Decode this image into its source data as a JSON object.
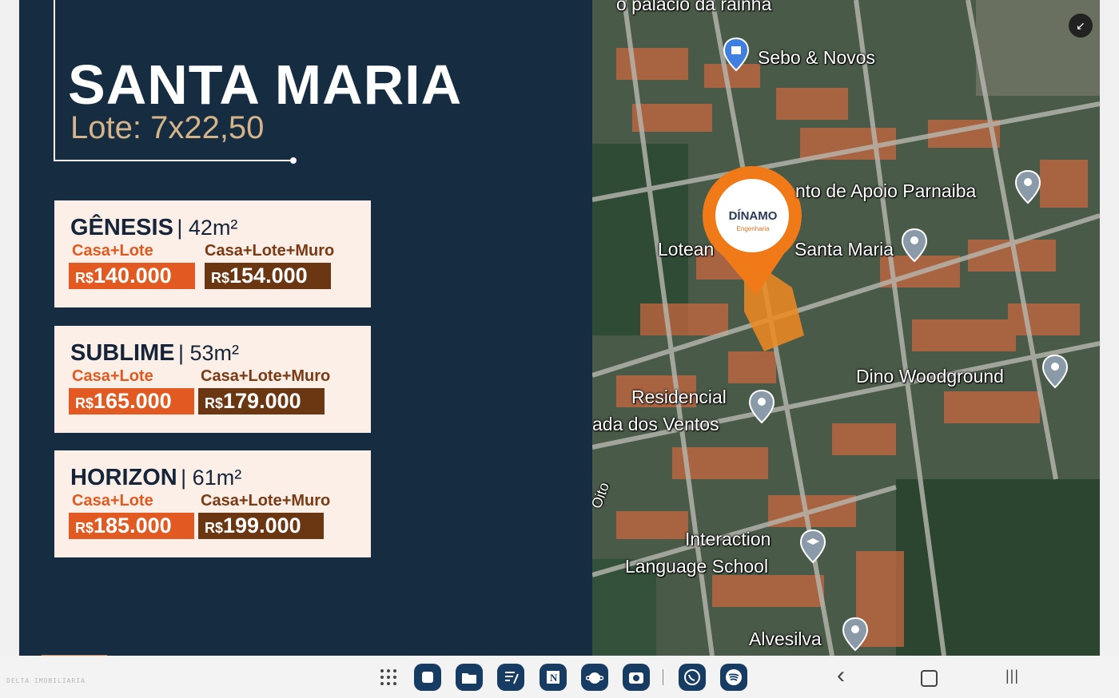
{
  "slide": {
    "title": "SANTA MARIA",
    "subtitle": "Lote: 7x22,50",
    "models": [
      {
        "name": "GÊNESIS",
        "size": "| 42m²",
        "label_1": "Casa+Lote",
        "label_2": "Casa+Lote+Muro",
        "currency": "R$",
        "price_1": "140.000",
        "price_2": "154.000"
      },
      {
        "name": "SUBLIME",
        "size": "| 53m²",
        "label_1": "Casa+Lote",
        "label_2": "Casa+Lote+Muro",
        "currency": "R$",
        "price_1": "165.000",
        "price_2": "179.000"
      },
      {
        "name": "HORIZON",
        "size": "| 61m²",
        "label_1": "Casa+Lote",
        "label_2": "Casa+Lote+Muro",
        "currency": "R$",
        "price_1": "185.000",
        "price_2": "199.000"
      }
    ],
    "colors": {
      "background": "#162c40",
      "accent": "#e25a21",
      "dark_accent": "#6b3612",
      "card": "#fcefe8"
    }
  },
  "map": {
    "labels": {
      "palace": "o palácio da rainha",
      "sebo": "Sebo & Novos",
      "centro": "nto de Apoio Parnaiba",
      "lote_left": "Lotean",
      "lote_right": "Santa Maria",
      "dino": "Dino Woodground",
      "res_1": "Residencial",
      "res_2": "ada dos Ventos",
      "interaction_1": "Interaction",
      "interaction_2": "Language School",
      "alvesilva": "Alvesilva",
      "rua": "Oito"
    },
    "pin_brand": "DÍNAMO",
    "pin_sub": "Engenharia",
    "collapse_icon": "↙"
  },
  "taskbar": {
    "device_label": "DELTA IMOBILIARIA",
    "apps": [
      "app-drawer-icon",
      "notes-icon",
      "files-icon",
      "editor-icon",
      "notion-icon",
      "planet-icon",
      "camera-icon",
      "whatsapp-icon",
      "spotify-icon"
    ],
    "nav_back": "‹",
    "nav_recents": "|||"
  }
}
